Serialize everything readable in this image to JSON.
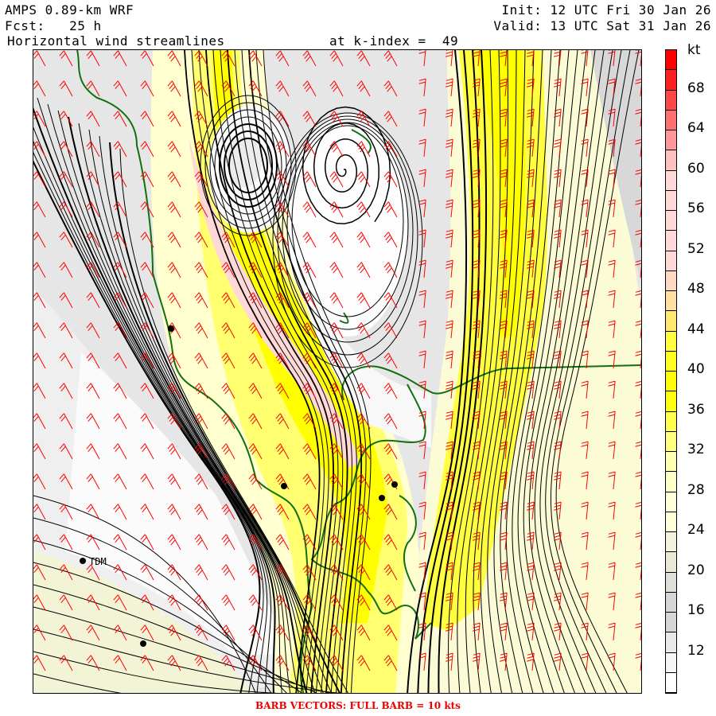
{
  "header": {
    "model": "AMPS 0.89-km WRF",
    "forecast": "Fcst:   25 h",
    "init": "Init: 12 UTC Fri 30 Jan 26",
    "valid": "Valid: 13 UTC Sat 31 Jan 26",
    "field": "Horizontal wind streamlines",
    "level": "at k-index =  49"
  },
  "colorbar": {
    "unit": "kt",
    "labels": [
      "68",
      "64",
      "60",
      "56",
      "52",
      "48",
      "44",
      "40",
      "36",
      "32",
      "28",
      "24",
      "20",
      "16",
      "12"
    ],
    "colors_bottom_to_top": [
      "#ffffff",
      "#f5f5f5",
      "#e8e8e8",
      "#d6d6d6",
      "#d6d6d6",
      "#dfdfd8",
      "#e9e9d6",
      "#f3f3dc",
      "#ffffd8",
      "#ffffd8",
      "#ffffc8",
      "#ffffb0",
      "#ffff80",
      "#ffff50",
      "#ffff10",
      "#ffff00",
      "#ffff20",
      "#ffff40",
      "#ffe870",
      "#ffe0a0",
      "#ffd9c2",
      "#ffd8d8",
      "#ffd8d8",
      "#ffd8d8",
      "#ffd8d8",
      "#ffd8d8",
      "#ffc0c0",
      "#ff9898",
      "#ff7070",
      "#ff4848",
      "#ff2020",
      "#ff0000"
    ]
  },
  "map": {
    "station_label": "TDM",
    "colors": {
      "coast": "#107010",
      "barb": "#ff0000",
      "stream": "#000000"
    }
  },
  "footer": "BARB VECTORS:  FULL BARB = 10 kts"
}
